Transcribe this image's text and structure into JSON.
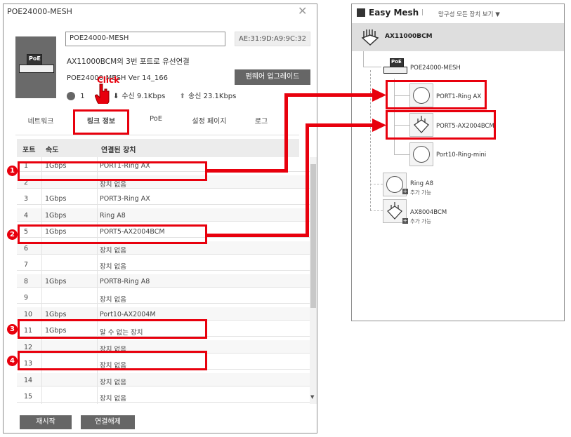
{
  "dialog": {
    "title": "POE24000-MESH",
    "device_name_value": "POE24000-MESH",
    "mac": "AE:31:9D:A9:9C:32",
    "link_desc": "AX11000BCM의 3번 포트로 유선연결",
    "fw_label": "POE24000-MESH  Ver 14_166",
    "fw_button": "펌웨어 업그레이드",
    "status_port": "1",
    "status_rx": "수신  9.1Kbps",
    "status_tx": "송신  23.1Kbps",
    "click_label": "Click",
    "tabs": [
      "네트워크",
      "링크 정보",
      "PoE",
      "설정 페이지",
      "로그"
    ],
    "table_headers": [
      "포트",
      "속도",
      "연결된 장치"
    ],
    "rows": [
      {
        "port": "1",
        "speed": "1Gbps",
        "device": "PORT1-Ring AX"
      },
      {
        "port": "2",
        "speed": "",
        "device": "장치 없음"
      },
      {
        "port": "3",
        "speed": "1Gbps",
        "device": "PORT3-Ring AX"
      },
      {
        "port": "4",
        "speed": "1Gbps",
        "device": "Ring A8"
      },
      {
        "port": "5",
        "speed": "1Gbps",
        "device": "PORT5-AX2004BCM"
      },
      {
        "port": "6",
        "speed": "",
        "device": "장치 없음"
      },
      {
        "port": "7",
        "speed": "",
        "device": "장치 없음"
      },
      {
        "port": "8",
        "speed": "1Gbps",
        "device": "PORT8-Ring A8"
      },
      {
        "port": "9",
        "speed": "",
        "device": "장치 없음"
      },
      {
        "port": "10",
        "speed": "1Gbps",
        "device": "Port10-AX2004M"
      },
      {
        "port": "11",
        "speed": "1Gbps",
        "device": "알 수 없는 장치"
      },
      {
        "port": "12",
        "speed": "",
        "device": "장치 없음"
      },
      {
        "port": "13",
        "speed": "",
        "device": "장치 없음"
      },
      {
        "port": "14",
        "speed": "",
        "device": "장치 없음"
      },
      {
        "port": "15",
        "speed": "",
        "device": "장치 없음"
      }
    ],
    "restart_button": "재시작",
    "disconnect_button": "연결해제",
    "badges": [
      "1",
      "2",
      "3",
      "4"
    ]
  },
  "mesh": {
    "title": "Easy Mesh",
    "subtitle": "망구성 모든 장치 보기 ▼",
    "root": "AX11000BCM",
    "poe": "POE24000-MESH",
    "poe_tag": "PoE",
    "port1": "PORT1-Ring AX",
    "port5": "PORT5-AX2004BCM",
    "port10": "Port10-Ring-mini",
    "ring_a8": "Ring A8",
    "ax8004": "AX8004BCM",
    "add_possible": "추가 가능"
  },
  "colors": {
    "highlight": "#e8000d",
    "button_gray": "#666666",
    "root_bar": "#dedede"
  }
}
